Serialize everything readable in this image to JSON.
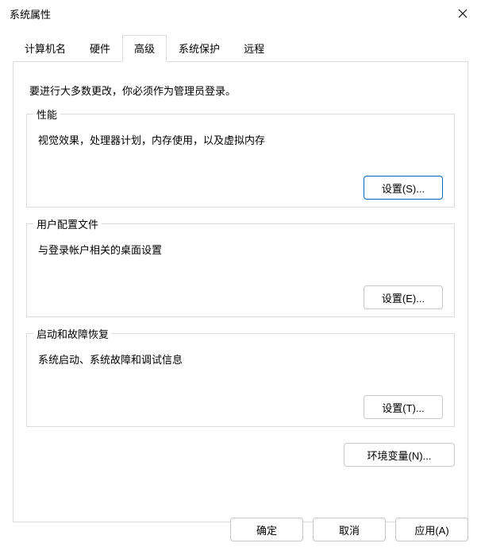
{
  "window": {
    "title": "系统属性"
  },
  "tabs": {
    "computer_name": "计算机名",
    "hardware": "硬件",
    "advanced": "高级",
    "system_protection": "系统保护",
    "remote": "远程"
  },
  "panel": {
    "admin_note": "要进行大多数更改，你必须作为管理员登录。",
    "performance": {
      "legend": "性能",
      "desc": "视觉效果，处理器计划，内存使用，以及虚拟内存",
      "button": "设置(S)..."
    },
    "user_profiles": {
      "legend": "用户配置文件",
      "desc": "与登录帐户相关的桌面设置",
      "button": "设置(E)..."
    },
    "startup_recovery": {
      "legend": "启动和故障恢复",
      "desc": "系统启动、系统故障和调试信息",
      "button": "设置(T)..."
    },
    "env_vars_button": "环境变量(N)..."
  },
  "dialog": {
    "ok": "确定",
    "cancel": "取消",
    "apply": "应用(A)"
  }
}
